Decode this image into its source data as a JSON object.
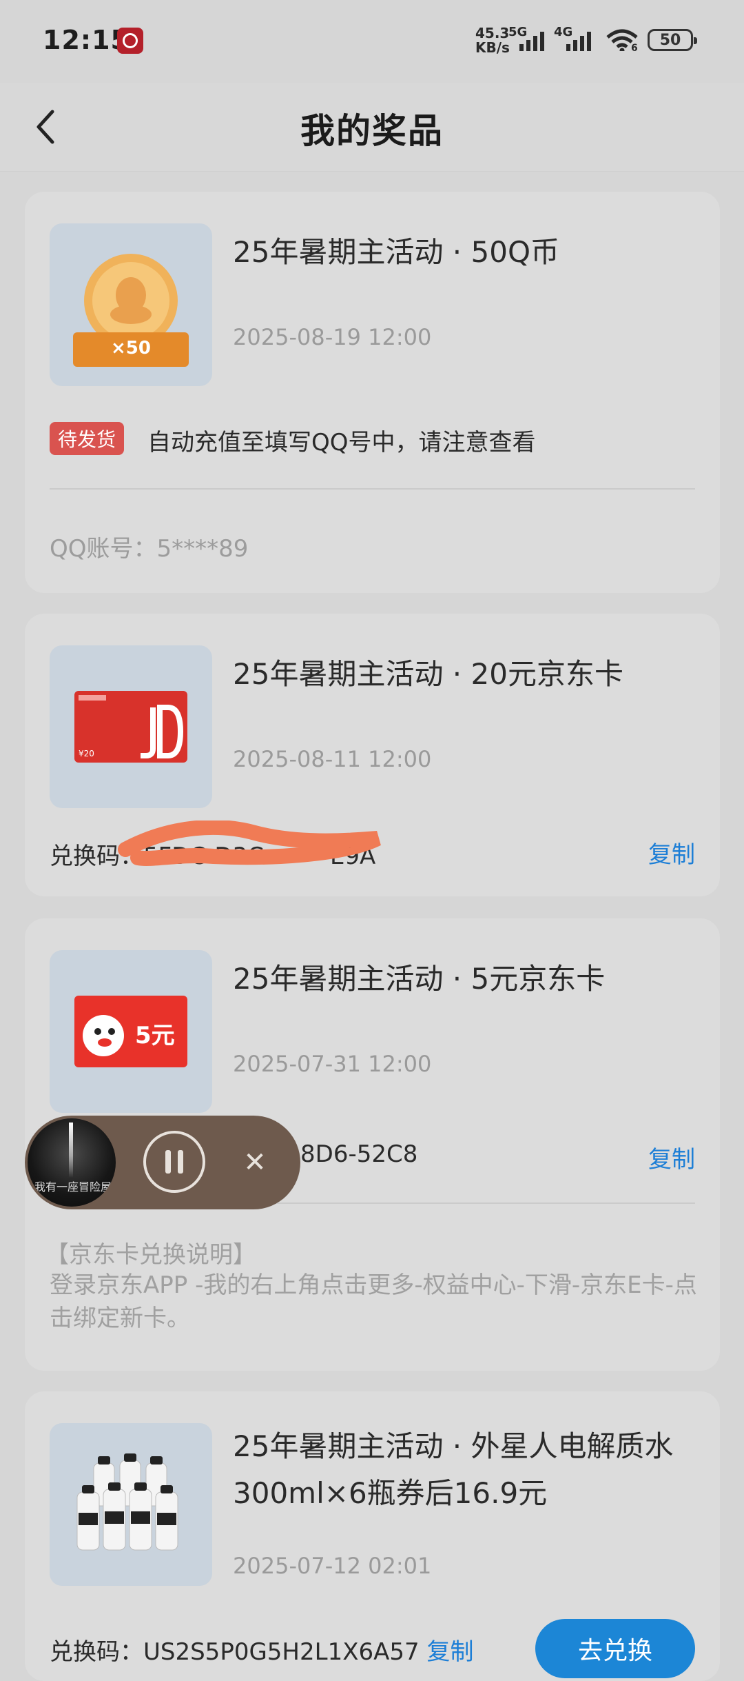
{
  "status_bar": {
    "time": "12:15",
    "net_speed_value": "45.3",
    "net_speed_unit": "KB/s",
    "signal1_label": "5G",
    "signal2_label": "4G",
    "wifi_sub": "6",
    "battery": "50"
  },
  "header": {
    "title": "我的奖品"
  },
  "prizes": [
    {
      "title": "25年暑期主活动 · 50Q币",
      "date": "2025-08-19 12:00",
      "coin_label": "×50",
      "status_tag": "待发货",
      "status_desc": "自动充值至填写QQ号中，请注意查看",
      "account": "QQ账号：5****89"
    },
    {
      "title": "25年暑期主活动 · 20元京东卡",
      "date": "2025-08-11 12:00",
      "card_face_brand": "JD",
      "card_face_value": "¥20",
      "code_label": "兑换码：5FDC-D3C",
      "code_tail": "E9A",
      "copy_label": "复制"
    },
    {
      "title": "25年暑期主活动 · 5元京东卡",
      "date": "2025-07-31 12:00",
      "card_face_value": "5元",
      "code_visible": "8D6-52C8",
      "copy_label": "复制",
      "note_title": "【京东卡兑换说明】",
      "note_body": "登录京东APP -我的右上角点击更多-权益中心-下滑-京东E卡-点击绑定新卡。"
    },
    {
      "title": "25年暑期主活动 · 外星人电解质水300ml×6瓶券后16.9元",
      "date": "2025-07-12 02:01",
      "code_label": "兑换码：US2S5P0G5H2L1X6A57",
      "copy_label": "复制",
      "redeem_label": "去兑换"
    }
  ],
  "player": {
    "cover_text": "我有一座冒险屋"
  },
  "colors": {
    "accent": "#1c86d6",
    "tag_red": "#d9534f",
    "redact": "#f07b55"
  }
}
